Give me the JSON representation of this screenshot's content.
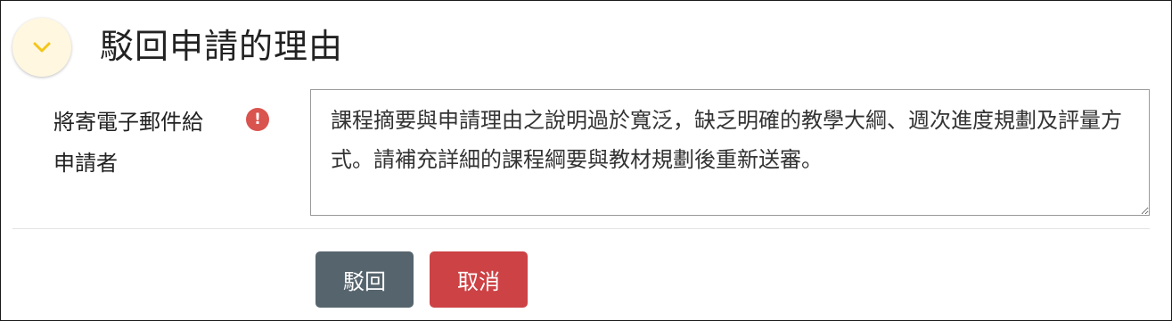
{
  "header": {
    "title": "駁回申請的理由",
    "toggle_icon": "chevron-down-icon"
  },
  "colors": {
    "toggle_bg": "#fff7e0",
    "chevron": "#f5c518",
    "alert": "#d9534f",
    "reject_button": "#56646d",
    "cancel_button": "#cd4245"
  },
  "form": {
    "email_label_line1": "將寄電子郵件給",
    "email_label_line2": "申請者",
    "alert_icon": "exclamation-circle-icon",
    "alert_glyph": "!",
    "reason_value": "課程摘要與申請理由之說明過於寬泛，缺乏明確的教學大綱、週次進度規劃及評量方式。請補充詳細的課程綱要與教材規劃後重新送審。"
  },
  "actions": {
    "reject_label": "駁回",
    "cancel_label": "取消"
  }
}
